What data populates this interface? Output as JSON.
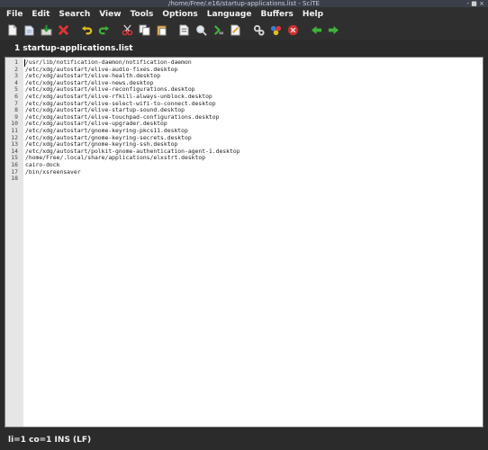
{
  "window": {
    "title": "/home/Free/.e16/startup-applications.list - SciTE",
    "controls": "-  ■  ×"
  },
  "menu": [
    "File",
    "Edit",
    "Search",
    "View",
    "Tools",
    "Options",
    "Language",
    "Buffers",
    "Help"
  ],
  "toolbar": [
    "new-icon",
    "open-icon",
    "save-icon",
    "close-icon",
    "undo-icon",
    "redo-icon",
    "cut-icon",
    "copy-icon",
    "paste-icon",
    "find-icon",
    "find-zoom-icon",
    "build-icon",
    "export-icon",
    "compile-icon",
    "go-icon",
    "stop-icon",
    "prev-icon",
    "next-icon"
  ],
  "tab": {
    "label": "1 startup-applications.list"
  },
  "lines": [
    {
      "n": "1",
      "t": "/usr/lib/notification-daemon/notification-daemon"
    },
    {
      "n": "2",
      "t": "/etc/xdg/autostart/elive-audio-fixes.desktop"
    },
    {
      "n": "3",
      "t": "/etc/xdg/autostart/elive-health.desktop"
    },
    {
      "n": "4",
      "t": "/etc/xdg/autostart/elive-news.desktop"
    },
    {
      "n": "5",
      "t": "/etc/xdg/autostart/elive-reconfigurations.desktop"
    },
    {
      "n": "6",
      "t": "/etc/xdg/autostart/elive-rfkill-always-unblock.desktop"
    },
    {
      "n": "7",
      "t": "/etc/xdg/autostart/elive-select-wifi-to-connect.desktop"
    },
    {
      "n": "8",
      "t": "/etc/xdg/autostart/elive-startup-sound.desktop"
    },
    {
      "n": "9",
      "t": "/etc/xdg/autostart/elive-touchpad-configurations.desktop"
    },
    {
      "n": "10",
      "t": "/etc/xdg/autostart/elive-upgrader.desktop"
    },
    {
      "n": "11",
      "t": "/etc/xdg/autostart/gnome-keyring-pkcs11.desktop"
    },
    {
      "n": "12",
      "t": "/etc/xdg/autostart/gnome-keyring-secrets.desktop"
    },
    {
      "n": "13",
      "t": "/etc/xdg/autostart/gnome-keyring-ssh.desktop"
    },
    {
      "n": "14",
      "t": "/etc/xdg/autostart/polkit-gnome-authentication-agent-1.desktop"
    },
    {
      "n": "15",
      "t": "/home/Free/.local/share/applications/elxstrt.desktop"
    },
    {
      "n": "16",
      "t": "cairo-dock"
    },
    {
      "n": "17",
      "t": "/bin/xsreensaver"
    },
    {
      "n": "18",
      "t": ""
    }
  ],
  "status": {
    "text": "li=1 co=1 INS (LF)"
  }
}
